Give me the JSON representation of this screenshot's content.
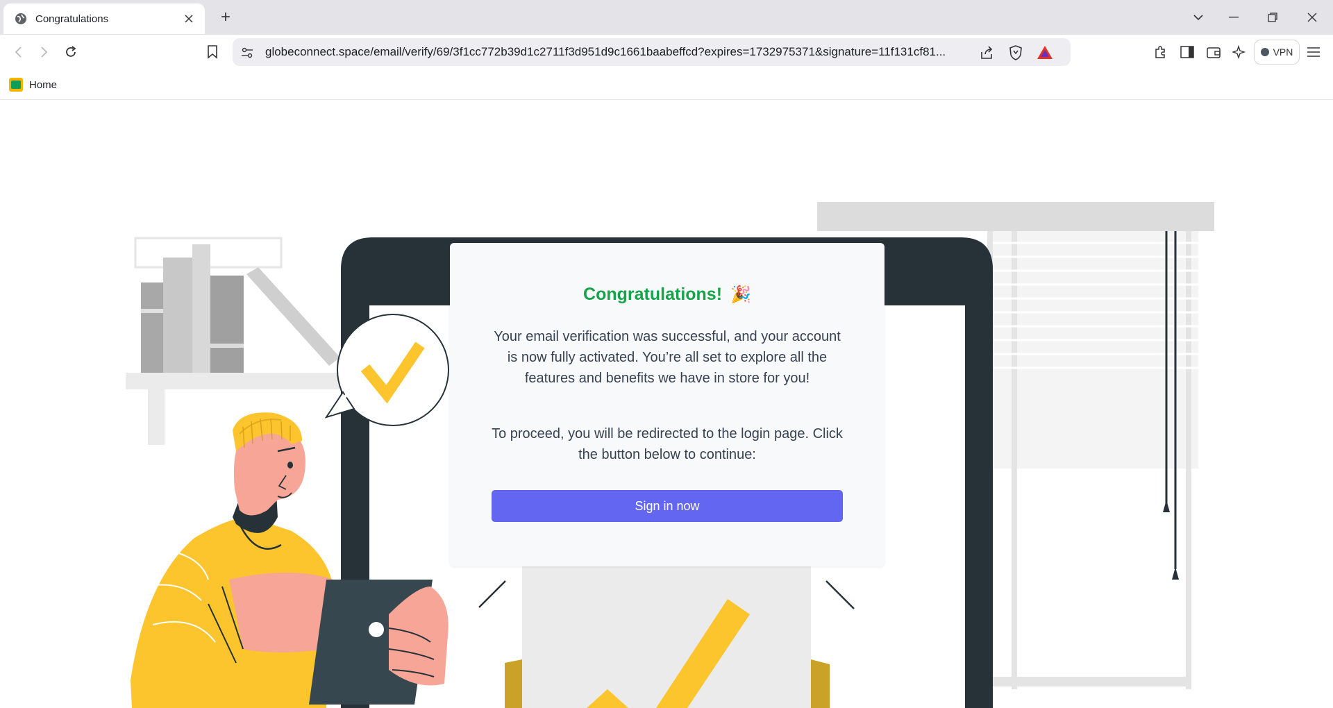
{
  "browser": {
    "tab": {
      "title": "Congratulations"
    },
    "new_tab_symbol": "+",
    "address_bar": {
      "url": "globeconnect.space/email/verify/69/3f1cc772b39d1c2711f3d951d9c1661baabeffcd?expires=1732975371&signature=11f131cf81..."
    },
    "vpn_label": "VPN",
    "bookmarks": [
      {
        "label": "Home"
      }
    ],
    "icons": {
      "tab_favicon": "globe-icon",
      "tab_close": "close-icon",
      "tab_search": "chevron-down-icon",
      "minimize": "minimize-icon",
      "restore": "restore-icon",
      "window_close": "close-icon",
      "back": "back-arrow-icon",
      "forward": "forward-arrow-icon",
      "reload": "reload-icon",
      "bookmark": "bookmark-icon",
      "site_settings": "site-settings-icon",
      "share": "share-icon",
      "shields": "brave-shields-icon",
      "rewards": "brave-rewards-icon",
      "extensions": "extensions-icon",
      "sidebar": "sidebar-icon",
      "wallet": "wallet-icon",
      "leo": "leo-ai-icon",
      "menu": "hamburger-menu-icon"
    }
  },
  "card": {
    "title": "Congratulations!",
    "title_emoji": "🎉",
    "paragraph1": "Your email verification was successful, and your account is now fully activated. You’re all set to explore all the features and benefits we have in store for you!",
    "paragraph2": "To proceed, you will be redirected to the login page. Click the button below to continue:",
    "button_label": "Sign in now"
  },
  "colors": {
    "title_green": "#16a34a",
    "button_indigo": "#6366f1",
    "illustration_yellow": "#fcc42d",
    "illustration_dark": "#263238"
  }
}
